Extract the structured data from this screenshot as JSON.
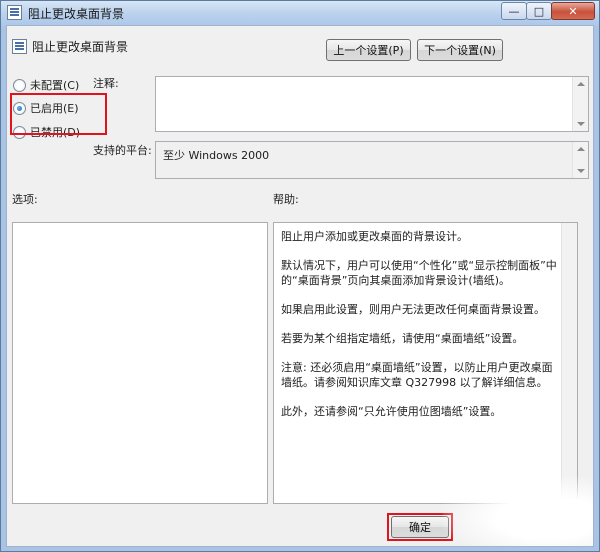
{
  "window": {
    "title": "阻止更改桌面背景",
    "minimize_glyph": "—",
    "maximize_glyph": "□",
    "close_glyph": "✕"
  },
  "header": {
    "title": "阻止更改桌面背景",
    "prev_button": "上一个设置(P)",
    "next_button": "下一个设置(N)"
  },
  "state": {
    "options": [
      {
        "label": "未配置(C)",
        "checked": false
      },
      {
        "label": "已启用(E)",
        "checked": true
      },
      {
        "label": "已禁用(D)",
        "checked": false
      }
    ]
  },
  "comment": {
    "label": "注释:",
    "value": ""
  },
  "platform": {
    "label": "支持的平台:",
    "value": "至少 Windows 2000"
  },
  "options_panel": {
    "label": "选项:"
  },
  "help_panel": {
    "label": "帮助:",
    "paragraphs": [
      "阻止用户添加或更改桌面的背景设计。",
      "默认情况下，用户可以使用“个性化”或“显示控制面板”中的“桌面背景”页向其桌面添加背景设计(墙纸)。",
      "如果启用此设置，则用户无法更改任何桌面背景设置。",
      "若要为某个组指定墙纸，请使用“桌面墙纸”设置。",
      "注意: 还必须启用“桌面墙纸”设置，以防止用户更改桌面墙纸。请参阅知识库文章 Q327998 以了解详细信息。",
      "此外，还请参阅“只允许使用位图墙纸”设置。"
    ]
  },
  "footer": {
    "ok_button": "确定"
  },
  "colors": {
    "highlight": "#e0141e",
    "window_frame": "#a9c3e4",
    "client_bg": "#f0f0f0"
  }
}
